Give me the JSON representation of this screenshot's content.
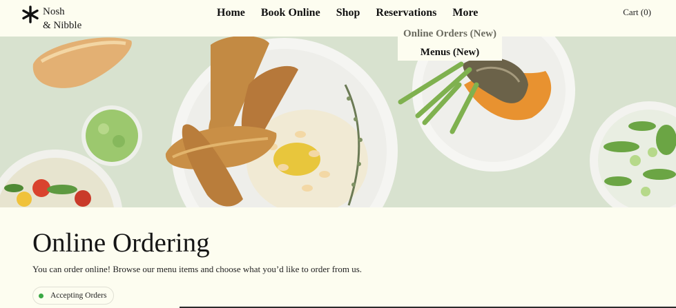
{
  "brand": {
    "line1": "Nosh",
    "line2": "& Nibble"
  },
  "nav": {
    "items": [
      {
        "label": "Home"
      },
      {
        "label": "Book Online"
      },
      {
        "label": "Shop"
      },
      {
        "label": "Reservations"
      },
      {
        "label": "More"
      }
    ],
    "cart_label": "Cart (0)"
  },
  "dropdown": {
    "items": [
      {
        "label": "Online Orders (New)"
      },
      {
        "label": "Menus (New)"
      }
    ]
  },
  "main": {
    "title": "Online Ordering",
    "description": "You can order online! Browse our menu items and choose what you’d like to order from us.",
    "status_badge": {
      "label": "Accepting Orders",
      "color": "#3aa844"
    }
  },
  "colors": {
    "background": "#fdfdf0",
    "hero_background": "#d8e2cf",
    "text": "#151515"
  }
}
